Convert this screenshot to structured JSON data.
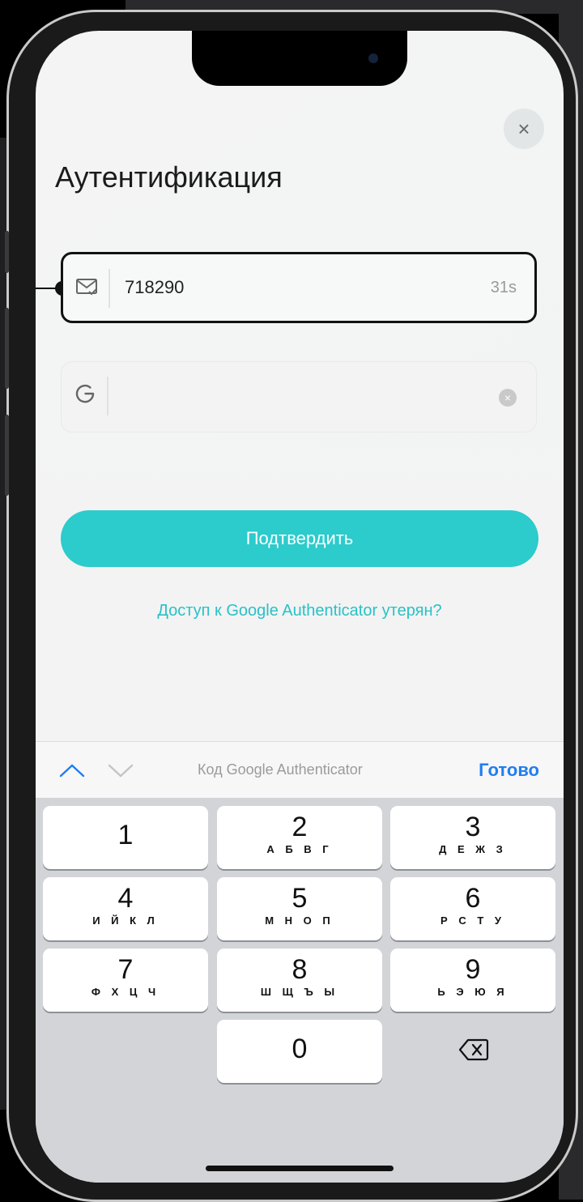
{
  "auth": {
    "title": "Аутентификация",
    "close_label": "×",
    "email_code": {
      "value": "718290",
      "timer": "31s"
    },
    "google_code": {
      "value": "",
      "clear_label": "×"
    },
    "confirm_label": "Подтвердить",
    "lost_access_link": "Доступ к Google Authenticator утерян?"
  },
  "keyboard_toolbar": {
    "hint": "Код Google Authenticator",
    "done_label": "Готово"
  },
  "keypad": {
    "keys": [
      {
        "digit": "1",
        "letters": ""
      },
      {
        "digit": "2",
        "letters": "А Б В Г"
      },
      {
        "digit": "3",
        "letters": "Д Е Ж З"
      },
      {
        "digit": "4",
        "letters": "И Й К Л"
      },
      {
        "digit": "5",
        "letters": "М Н О П"
      },
      {
        "digit": "6",
        "letters": "Р С Т У"
      },
      {
        "digit": "7",
        "letters": "Ф Х Ц Ч"
      },
      {
        "digit": "8",
        "letters": "Ш Щ Ъ Ы"
      },
      {
        "digit": "9",
        "letters": "Ь Э Ю Я"
      },
      {
        "digit": "0",
        "letters": ""
      }
    ]
  },
  "colors": {
    "accent": "#2ccbcc",
    "link": "#28c2c6",
    "done": "#1f7ef1"
  },
  "icons": [
    "mail-check-icon",
    "google-g-icon",
    "close-icon",
    "clear-icon",
    "chevron-up-icon",
    "chevron-down-icon",
    "backspace-icon"
  ]
}
